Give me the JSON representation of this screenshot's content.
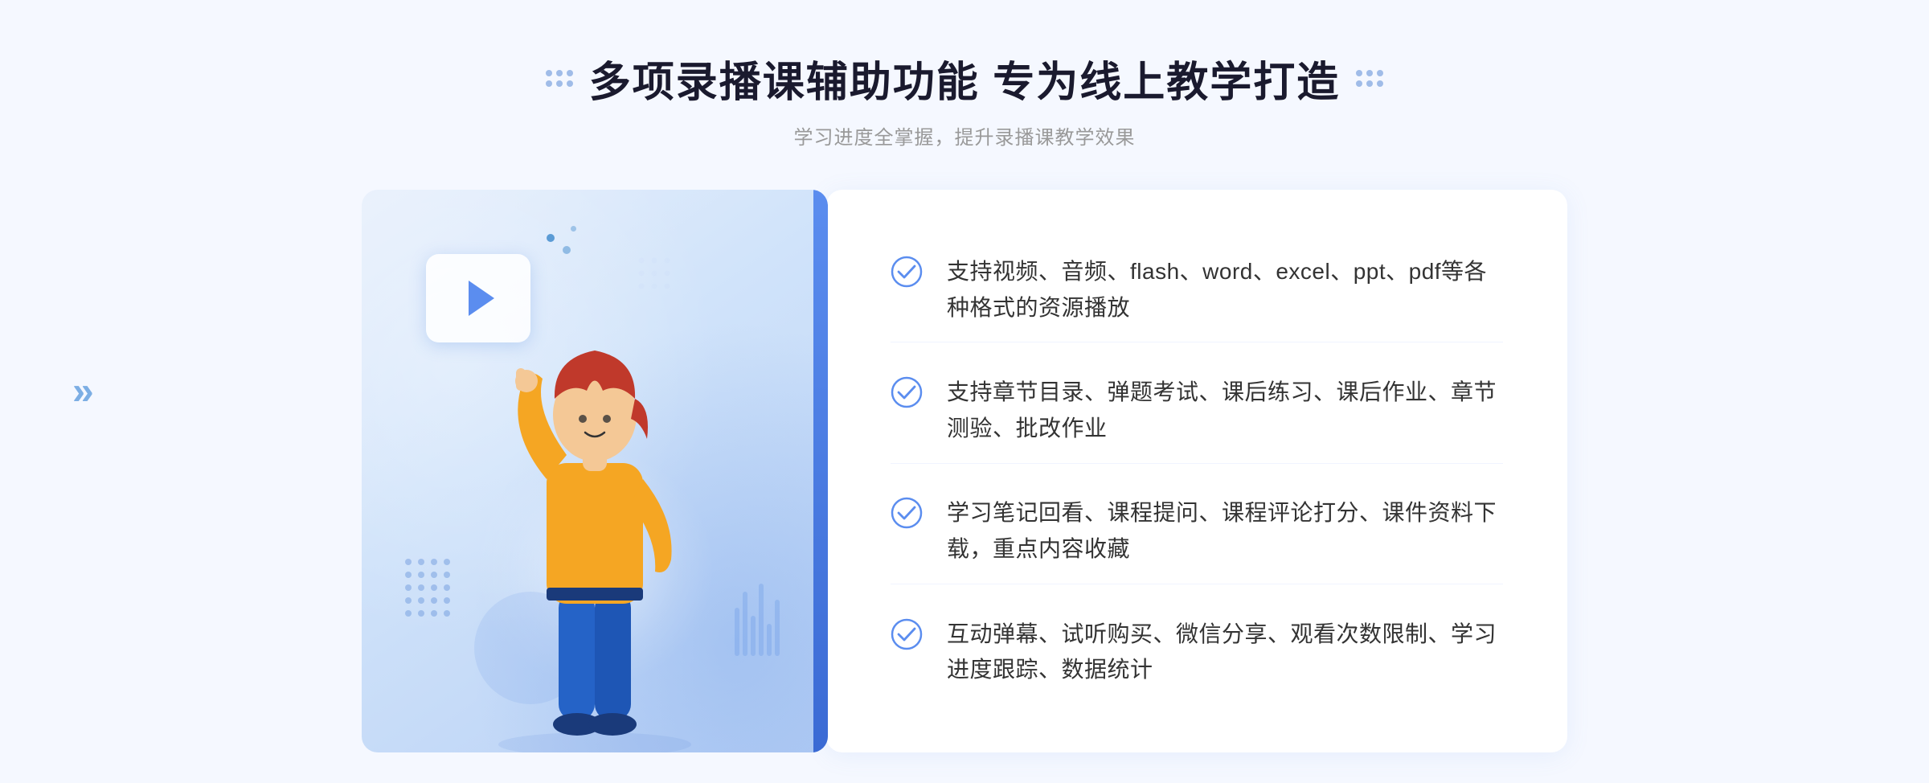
{
  "page": {
    "background_color": "#f5f8ff"
  },
  "header": {
    "title": "多项录播课辅助功能 专为线上教学打造",
    "subtitle": "学习进度全掌握，提升录播课教学效果",
    "dots_decoration": true
  },
  "features": [
    {
      "id": 1,
      "text": "支持视频、音频、flash、word、excel、ppt、pdf等各种格式的资源播放",
      "icon": "check-circle"
    },
    {
      "id": 2,
      "text": "支持章节目录、弹题考试、课后练习、课后作业、章节测验、批改作业",
      "icon": "check-circle"
    },
    {
      "id": 3,
      "text": "学习笔记回看、课程提问、课程评论打分、课件资料下载，重点内容收藏",
      "icon": "check-circle"
    },
    {
      "id": 4,
      "text": "互动弹幕、试听购买、微信分享、观看次数限制、学习进度跟踪、数据统计",
      "icon": "check-circle"
    }
  ],
  "decoration": {
    "chevron_left": "»",
    "check_color": "#5b8def"
  }
}
